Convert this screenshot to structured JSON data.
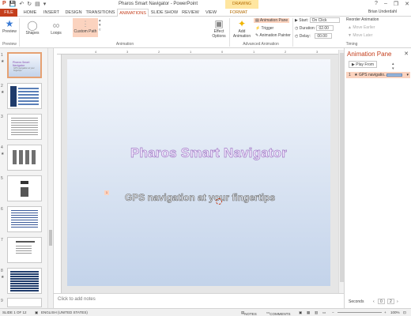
{
  "window": {
    "title": "Pharos Smart Navigator - PowerPoint",
    "drawing_tools_label": "DRAWING TOOLS",
    "user": "Brian Underdahl",
    "controls": [
      "?",
      "–",
      "❐",
      "✕"
    ]
  },
  "qat": [
    "P",
    "💾",
    "↶",
    "↻",
    "▤",
    "▾"
  ],
  "tabs": [
    "FILE",
    "HOME",
    "INSERT",
    "DESIGN",
    "TRANSITIONS",
    "ANIMATIONS",
    "SLIDE SHOW",
    "REVIEW",
    "VIEW",
    "FORMAT"
  ],
  "active_tab": "ANIMATIONS",
  "ribbon": {
    "preview": {
      "label": "Preview",
      "group": "Preview"
    },
    "effects": [
      {
        "label": "Shapes",
        "icon": "shapes-icon"
      },
      {
        "label": "Loops",
        "icon": "loops-icon"
      },
      {
        "label": "Custom Path",
        "icon": "custom-path-icon"
      }
    ],
    "effect_options": {
      "label1": "Effect",
      "label2": "Options"
    },
    "animation_group": "Animation",
    "add_animation": {
      "label1": "Add",
      "label2": "Animation"
    },
    "animation_pane": "Animation Pane",
    "trigger": "Trigger",
    "animation_painter": "Animation Painter",
    "advanced_group": "Advanced Animation",
    "start_label": "Start:",
    "start_value": "On Click",
    "duration_label": "Duration:",
    "duration_value": "02.00",
    "delay_label": "Delay:",
    "delay_value": "00.00",
    "timing_group": "Timing",
    "reorder_title": "Reorder Animation",
    "move_earlier": "Move Earlier",
    "move_later": "Move Later"
  },
  "thumbnails": {
    "numbers": [
      "1",
      "2",
      "3",
      "4",
      "5",
      "6",
      "7",
      "8",
      "9"
    ],
    "selected": 1,
    "slide1_title": "Pharos Smart Navigator",
    "slide1_sub": "GPS navigation at your fingertips"
  },
  "ruler_ticks": [
    "4",
    "3",
    "2",
    "1",
    "0",
    "1",
    "2",
    "3",
    "4"
  ],
  "slide": {
    "title": "Pharos Smart Navigator",
    "subtitle": "GPS navigation at your fingertips",
    "anim_tag": "1"
  },
  "notes_placeholder": "Click to add notes",
  "anim_pane": {
    "title": "Animation Pane",
    "play_from": "Play From",
    "item_num": "1",
    "item_label": "GPS navigatio...",
    "seconds": "Seconds",
    "seconds_box": "0",
    "seconds_box2": "2"
  },
  "status": {
    "slide": "SLIDE 1 OF 12",
    "language": "ENGLISH (UNITED STATES)",
    "notes": "NOTES",
    "comments": "COMMENTS",
    "zoom": "100%"
  },
  "colors": {
    "accent": "#c43e1c",
    "title_outline": "#a07bc4",
    "selected_item": "#fbd3bf"
  }
}
